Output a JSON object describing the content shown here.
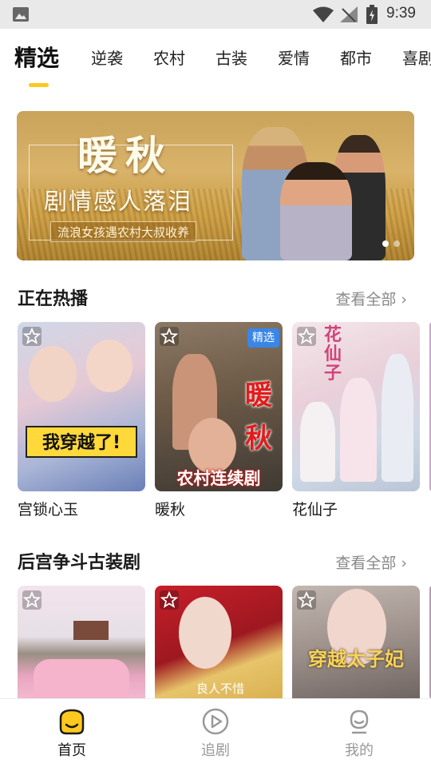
{
  "status_bar": {
    "time": "9:39"
  },
  "tabs": [
    {
      "label": "精选",
      "active": true
    },
    {
      "label": "逆袭"
    },
    {
      "label": "农村"
    },
    {
      "label": "古装"
    },
    {
      "label": "爱情"
    },
    {
      "label": "都市"
    },
    {
      "label": "喜剧"
    }
  ],
  "banner": {
    "title": "暖秋",
    "subtitle": "剧情感人落泪",
    "tagline": "流浪女孩遇农村大叔收养",
    "page_count": 2,
    "current_page": 1
  },
  "sections": [
    {
      "title": "正在热播",
      "more_label": "查看全部",
      "cards": [
        {
          "name": "宫锁心玉",
          "poster_text": "我穿越了!"
        },
        {
          "name": "暖秋",
          "badge": "精选",
          "poster_text_1": "暖",
          "poster_text_2": "秋",
          "poster_text_3": "农村连续剧"
        },
        {
          "name": "花仙子",
          "poster_text": "花仙子"
        }
      ]
    },
    {
      "title": "后宫争斗古装剧",
      "more_label": "查看全部",
      "cards": [
        {
          "name": ""
        },
        {
          "name": "",
          "poster_text": "良人不惜"
        },
        {
          "name": "",
          "poster_text": "穿越太子妃"
        }
      ]
    }
  ],
  "bottom_nav": [
    {
      "label": "首页",
      "icon": "home-face-icon",
      "active": true
    },
    {
      "label": "追剧",
      "icon": "play-circle-icon"
    },
    {
      "label": "我的",
      "icon": "profile-face-icon"
    }
  ],
  "colors": {
    "accent": "#ffc81e",
    "badge": "#3a86e8"
  }
}
